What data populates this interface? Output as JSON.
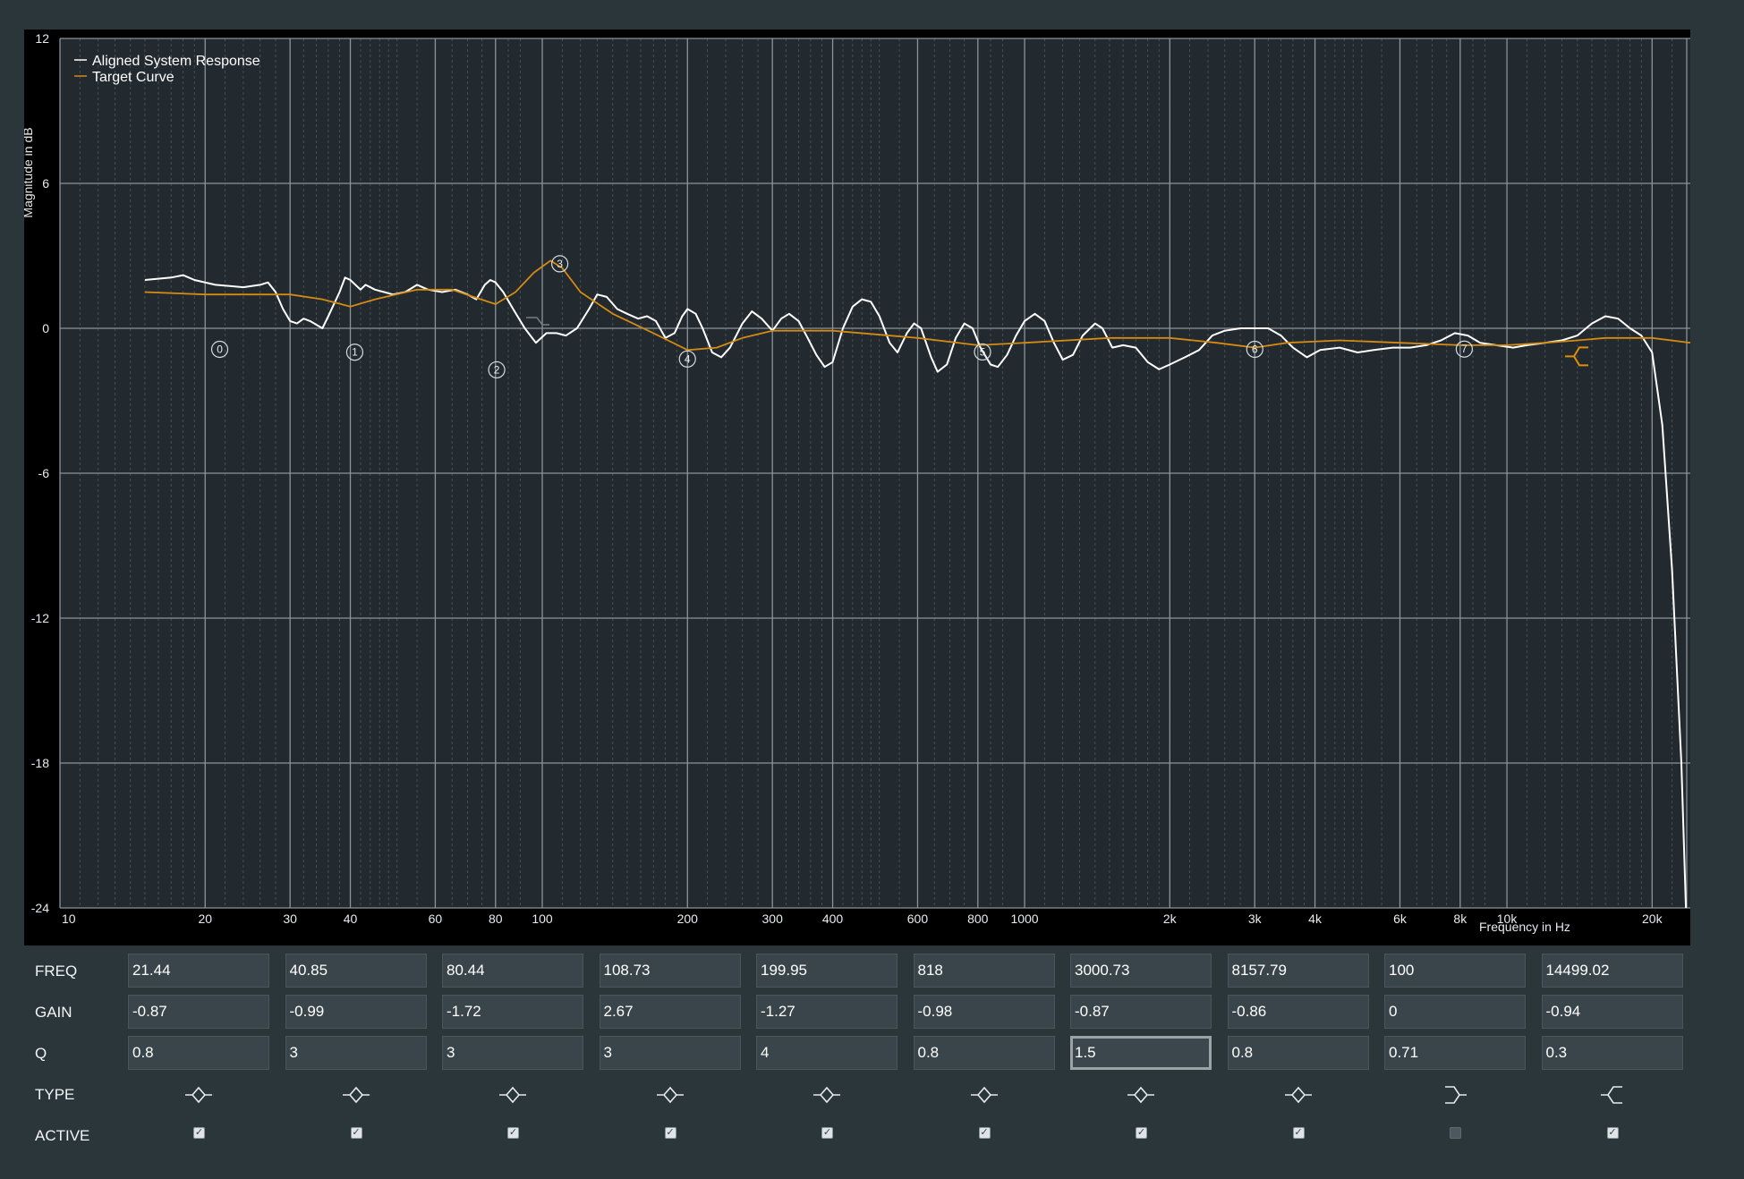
{
  "chart_data": {
    "type": "line",
    "xscale": "log",
    "xlim": [
      10,
      24000
    ],
    "ylim": [
      -24,
      12
    ],
    "ylabel": "Magnitude in dB",
    "xlabel": "Frequency in Hz",
    "grid": true,
    "legend_position": "top-left",
    "y_ticks": [
      12,
      6,
      0,
      -6,
      -12,
      -18,
      -24
    ],
    "y_tick_labels": [
      "12",
      "6",
      "0",
      "-6",
      "-12",
      "-18",
      "-24"
    ],
    "x_ticks": [
      10,
      20,
      30,
      40,
      60,
      80,
      100,
      200,
      300,
      400,
      600,
      800,
      1000,
      2000,
      3000,
      4000,
      6000,
      8000,
      10000,
      20000
    ],
    "x_tick_labels": [
      "10",
      "20",
      "30",
      "40",
      "60",
      "80",
      "100",
      "200",
      "300",
      "400",
      "600",
      "800",
      "1000",
      "2k",
      "3k",
      "4k",
      "6k",
      "8k",
      "10k",
      "20k"
    ],
    "series": [
      {
        "name": "Aligned System Response",
        "color": "#ffffff",
        "points": [
          [
            15,
            2
          ],
          [
            17,
            2.1
          ],
          [
            18,
            2.2
          ],
          [
            19,
            2
          ],
          [
            21,
            1.8
          ],
          [
            24,
            1.7
          ],
          [
            26,
            1.8
          ],
          [
            27,
            1.9
          ],
          [
            28,
            1.5
          ],
          [
            29,
            0.8
          ],
          [
            30,
            0.3
          ],
          [
            31,
            0.2
          ],
          [
            32,
            0.4
          ],
          [
            33,
            0.3
          ],
          [
            35,
            0
          ],
          [
            36,
            0.5
          ],
          [
            38,
            1.5
          ],
          [
            39,
            2.1
          ],
          [
            40,
            2
          ],
          [
            42,
            1.6
          ],
          [
            43,
            1.8
          ],
          [
            45,
            1.6
          ],
          [
            47,
            1.5
          ],
          [
            49,
            1.4
          ],
          [
            52,
            1.5
          ],
          [
            55,
            1.8
          ],
          [
            58,
            1.6
          ],
          [
            62,
            1.5
          ],
          [
            66,
            1.6
          ],
          [
            70,
            1.4
          ],
          [
            73,
            1.2
          ],
          [
            76,
            1.8
          ],
          [
            78,
            2
          ],
          [
            80,
            1.9
          ],
          [
            83,
            1.5
          ],
          [
            87,
            0.8
          ],
          [
            92,
            0
          ],
          [
            97,
            -0.6
          ],
          [
            102,
            -0.2
          ],
          [
            107,
            -0.2
          ],
          [
            112,
            -0.3
          ],
          [
            118,
            0
          ],
          [
            125,
            0.8
          ],
          [
            130,
            1.4
          ],
          [
            136,
            1.3
          ],
          [
            143,
            0.8
          ],
          [
            150,
            0.6
          ],
          [
            158,
            0.4
          ],
          [
            165,
            0.5
          ],
          [
            172,
            0.3
          ],
          [
            180,
            -0.4
          ],
          [
            188,
            -0.2
          ],
          [
            195,
            0.5
          ],
          [
            200,
            0.8
          ],
          [
            208,
            0.6
          ],
          [
            215,
            0
          ],
          [
            225,
            -1
          ],
          [
            235,
            -1.2
          ],
          [
            245,
            -0.8
          ],
          [
            260,
            0.2
          ],
          [
            272,
            0.7
          ],
          [
            285,
            0.4
          ],
          [
            300,
            -0.1
          ],
          [
            313,
            0.4
          ],
          [
            325,
            0.6
          ],
          [
            340,
            0.3
          ],
          [
            355,
            -0.4
          ],
          [
            370,
            -1.1
          ],
          [
            385,
            -1.6
          ],
          [
            400,
            -1.4
          ],
          [
            420,
            0
          ],
          [
            440,
            0.9
          ],
          [
            460,
            1.2
          ],
          [
            480,
            1.1
          ],
          [
            500,
            0.5
          ],
          [
            525,
            -0.6
          ],
          [
            545,
            -1
          ],
          [
            570,
            -0.2
          ],
          [
            590,
            0.2
          ],
          [
            610,
            0
          ],
          [
            640,
            -1.2
          ],
          [
            660,
            -1.8
          ],
          [
            690,
            -1.5
          ],
          [
            720,
            -0.4
          ],
          [
            750,
            0.2
          ],
          [
            780,
            0
          ],
          [
            810,
            -0.8
          ],
          [
            850,
            -1.5
          ],
          [
            880,
            -1.6
          ],
          [
            920,
            -1.1
          ],
          [
            960,
            -0.3
          ],
          [
            1000,
            0.3
          ],
          [
            1050,
            0.6
          ],
          [
            1100,
            0.3
          ],
          [
            1150,
            -0.6
          ],
          [
            1200,
            -1.3
          ],
          [
            1260,
            -1.1
          ],
          [
            1320,
            -0.3
          ],
          [
            1400,
            0.2
          ],
          [
            1450,
            0
          ],
          [
            1520,
            -0.8
          ],
          [
            1600,
            -0.7
          ],
          [
            1700,
            -0.8
          ],
          [
            1800,
            -1.4
          ],
          [
            1900,
            -1.7
          ],
          [
            2000,
            -1.5
          ],
          [
            2150,
            -1.2
          ],
          [
            2300,
            -0.9
          ],
          [
            2450,
            -0.3
          ],
          [
            2600,
            -0.1
          ],
          [
            2800,
            0
          ],
          [
            3000,
            0
          ],
          [
            3200,
            0
          ],
          [
            3400,
            -0.3
          ],
          [
            3600,
            -0.8
          ],
          [
            3850,
            -1.2
          ],
          [
            4100,
            -0.9
          ],
          [
            4500,
            -0.8
          ],
          [
            4900,
            -1
          ],
          [
            5300,
            -0.9
          ],
          [
            5800,
            -0.8
          ],
          [
            6300,
            -0.8
          ],
          [
            6800,
            -0.7
          ],
          [
            7300,
            -0.5
          ],
          [
            7800,
            -0.2
          ],
          [
            8300,
            -0.3
          ],
          [
            8800,
            -0.6
          ],
          [
            9500,
            -0.7
          ],
          [
            10300,
            -0.8
          ],
          [
            11000,
            -0.7
          ],
          [
            12000,
            -0.6
          ],
          [
            13000,
            -0.5
          ],
          [
            14000,
            -0.3
          ],
          [
            15000,
            0.2
          ],
          [
            16000,
            0.5
          ],
          [
            17000,
            0.4
          ],
          [
            18000,
            0
          ],
          [
            19000,
            -0.3
          ],
          [
            20000,
            -1
          ],
          [
            21000,
            -4
          ],
          [
            22000,
            -10
          ],
          [
            23000,
            -18
          ],
          [
            23500,
            -24
          ]
        ]
      },
      {
        "name": "Target Curve",
        "color": "#d48a14",
        "points": [
          [
            15,
            1.5
          ],
          [
            20,
            1.4
          ],
          [
            25,
            1.4
          ],
          [
            30,
            1.4
          ],
          [
            35,
            1.2
          ],
          [
            40,
            0.9
          ],
          [
            45,
            1.2
          ],
          [
            55,
            1.6
          ],
          [
            65,
            1.6
          ],
          [
            72,
            1.3
          ],
          [
            80,
            1
          ],
          [
            88,
            1.5
          ],
          [
            96,
            2.3
          ],
          [
            104,
            2.8
          ],
          [
            110,
            2.5
          ],
          [
            120,
            1.5
          ],
          [
            140,
            0.6
          ],
          [
            170,
            -0.2
          ],
          [
            200,
            -0.9
          ],
          [
            230,
            -0.8
          ],
          [
            260,
            -0.4
          ],
          [
            300,
            -0.1
          ],
          [
            400,
            -0.1
          ],
          [
            600,
            -0.4
          ],
          [
            800,
            -0.7
          ],
          [
            1000,
            -0.6
          ],
          [
            1500,
            -0.4
          ],
          [
            2000,
            -0.4
          ],
          [
            2500,
            -0.6
          ],
          [
            3000,
            -0.8
          ],
          [
            3500,
            -0.6
          ],
          [
            4500,
            -0.5
          ],
          [
            6000,
            -0.6
          ],
          [
            8000,
            -0.7
          ],
          [
            10000,
            -0.7
          ],
          [
            12000,
            -0.6
          ],
          [
            14000,
            -0.5
          ],
          [
            16000,
            -0.4
          ],
          [
            20000,
            -0.4
          ],
          [
            24000,
            -0.6
          ]
        ]
      }
    ],
    "filter_markers": [
      {
        "label": "0",
        "freq": 21.44,
        "gain": -0.87
      },
      {
        "label": "1",
        "freq": 40.85,
        "gain": -0.99
      },
      {
        "label": "2",
        "freq": 80.44,
        "gain": -1.72
      },
      {
        "label": "3",
        "freq": 108.73,
        "gain": 2.67
      },
      {
        "label": "4",
        "freq": 199.95,
        "gain": -1.27
      },
      {
        "label": "5",
        "freq": 818,
        "gain": -0.98
      },
      {
        "label": "6",
        "freq": 3000.73,
        "gain": -0.87
      },
      {
        "label": "7",
        "freq": 8157.79,
        "gain": -0.86
      }
    ]
  },
  "params": {
    "labels": {
      "freq": "FREQ",
      "gain": "GAIN",
      "q": "Q",
      "type": "TYPE",
      "active": "ACTIVE"
    },
    "bands": [
      {
        "freq": "21.44",
        "gain": "-0.87",
        "q": "0.8",
        "type": "peak",
        "active": true
      },
      {
        "freq": "40.85",
        "gain": "-0.99",
        "q": "3",
        "type": "peak",
        "active": true
      },
      {
        "freq": "80.44",
        "gain": "-1.72",
        "q": "3",
        "type": "peak",
        "active": true
      },
      {
        "freq": "108.73",
        "gain": "2.67",
        "q": "3",
        "type": "peak",
        "active": true
      },
      {
        "freq": "199.95",
        "gain": "-1.27",
        "q": "4",
        "type": "peak",
        "active": true
      },
      {
        "freq": "818",
        "gain": "-0.98",
        "q": "0.8",
        "type": "peak",
        "active": true
      },
      {
        "freq": "3000.73",
        "gain": "-0.87",
        "q": "1.5",
        "type": "peak",
        "active": true
      },
      {
        "freq": "8157.79",
        "gain": "-0.86",
        "q": "0.8",
        "type": "peak",
        "active": true
      },
      {
        "freq": "100",
        "gain": "0",
        "q": "0.71",
        "type": "low-shelf",
        "active": false
      },
      {
        "freq": "14499.02",
        "gain": "-0.94",
        "q": "0.3",
        "type": "high-shelf",
        "active": true
      }
    ],
    "focused_band": 6
  }
}
